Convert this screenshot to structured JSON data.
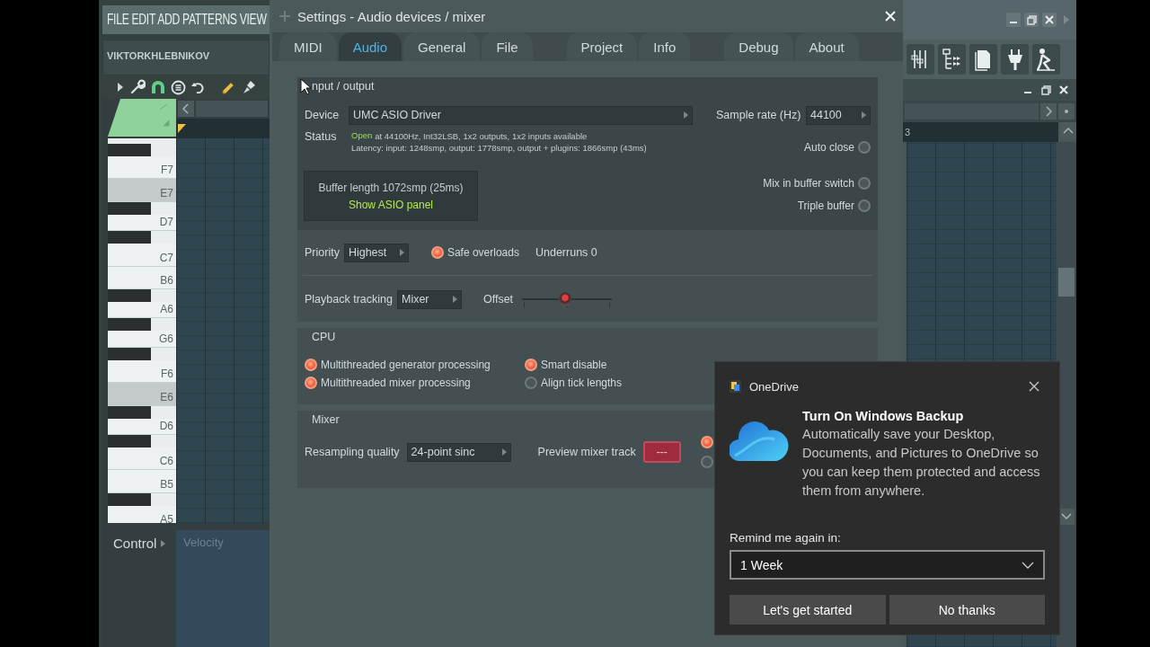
{
  "app": {
    "menu": "FILE EDIT ADD PATTERNS VIEW",
    "hint": "VIKTORKHLEBNIKOV"
  },
  "piano_roll": {
    "keys": [
      {
        "label": "F7",
        "black_key_above": true,
        "highlighted": false
      },
      {
        "label": "E7",
        "black_key_above": false,
        "highlighted": true
      },
      {
        "label": "D7",
        "black_key_above": true,
        "highlighted": false
      },
      {
        "label": "C7",
        "black_key_above": true,
        "highlighted": false
      },
      {
        "label": "B6",
        "black_key_above": false,
        "highlighted": false
      },
      {
        "label": "A6",
        "black_key_above": true,
        "highlighted": false
      },
      {
        "label": "G6",
        "black_key_above": true,
        "highlighted": false
      },
      {
        "label": "F6",
        "black_key_above": true,
        "highlighted": false
      },
      {
        "label": "E6",
        "black_key_above": false,
        "highlighted": true
      },
      {
        "label": "D6",
        "black_key_above": true,
        "highlighted": false
      },
      {
        "label": "C6",
        "black_key_above": true,
        "highlighted": false
      },
      {
        "label": "B5",
        "black_key_above": false,
        "highlighted": false
      },
      {
        "label": "A5",
        "black_key_above": true,
        "highlighted": false
      }
    ],
    "ruler_label": "3",
    "control": "Control",
    "control_target": "Velocity"
  },
  "settings": {
    "title": "Settings - Audio devices / mixer",
    "tab_groups": [
      [
        {
          "label": "MIDI",
          "selected": false
        },
        {
          "label": "Audio",
          "selected": true
        },
        {
          "label": "General",
          "selected": false
        },
        {
          "label": "File",
          "selected": false
        }
      ],
      [
        {
          "label": "Project",
          "selected": false
        },
        {
          "label": "Info",
          "selected": false
        }
      ],
      [
        {
          "label": "Debug",
          "selected": false
        },
        {
          "label": "About",
          "selected": false
        }
      ]
    ],
    "input_output": {
      "heading": "nput / output",
      "device_label": "Device",
      "device": "UMC ASIO Driver",
      "sample_rate_label": "Sample rate (Hz)",
      "sample_rate": "44100",
      "status_label": "Status",
      "status_state": "Open",
      "status_detail": "at 44100Hz, Int32LSB, 1x2 outputs, 1x2 inputs available",
      "latency": "Latency: input: 1248smp, output: 1778smp, output + plugins: 1866smp (43ms)",
      "auto_close": {
        "label": "Auto close",
        "checked": false
      },
      "buffer_length": "Buffer length 1072smp (25ms)",
      "asio_link": "Show ASIO panel",
      "buffer_options": [
        {
          "label": "Mix in buffer switch",
          "checked": false
        },
        {
          "label": "Triple buffer",
          "checked": false
        }
      ],
      "priority_label": "Priority",
      "priority": "Highest",
      "safe_overloads": {
        "label": "Safe overloads",
        "checked": true
      },
      "underruns": "Underruns 0",
      "tracking_label": "Playback tracking",
      "tracking": "Mixer",
      "offset_label": "Offset",
      "offset": {
        "level": 0.48
      }
    },
    "cpu": {
      "heading": "CPU",
      "options": [
        {
          "label": "Multithreaded generator processing",
          "checked": true
        },
        {
          "label": "Smart disable",
          "checked": true
        },
        {
          "label": "Multithreaded mixer processing",
          "checked": true
        },
        {
          "label": "Align tick lengths",
          "checked": false
        }
      ]
    },
    "mixer": {
      "heading": "Mixer",
      "resampling_label": "Resampling quality",
      "resampling": "24-point sinc",
      "preview_label": "Preview mixer track",
      "preview_track": "---",
      "options": [
        {
          "checked": true
        },
        {
          "checked": false
        }
      ]
    }
  },
  "notification": {
    "app": "OneDrive",
    "title": "Turn On Windows Backup",
    "body": "Automatically save your Desktop, Documents, and Pictures to OneDrive so you can keep them protected and access them from anywhere.",
    "remind_label": "Remind me again in:",
    "remind_value": "1 Week",
    "buttons": [
      "Let's get started",
      "No thanks"
    ]
  }
}
